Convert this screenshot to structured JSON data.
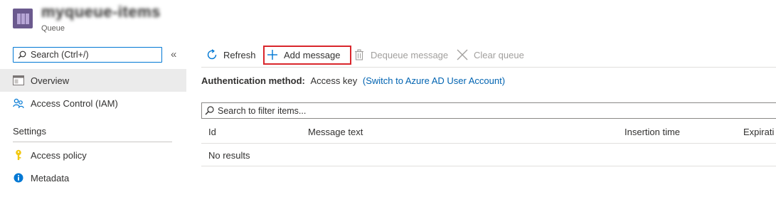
{
  "header": {
    "title": "myqueue-items",
    "subtitle": "Queue"
  },
  "sidebar": {
    "search_label": "Search (Ctrl+/)",
    "collapse_glyph": "«",
    "items": [
      {
        "label": "Overview",
        "icon": "overview-icon"
      },
      {
        "label": "Access Control (IAM)",
        "icon": "people-icon"
      }
    ],
    "section_label": "Settings",
    "settings_items": [
      {
        "label": "Access policy",
        "icon": "key-icon"
      },
      {
        "label": "Metadata",
        "icon": "info-icon"
      }
    ]
  },
  "toolbar": {
    "refresh": "Refresh",
    "add_message": "Add message",
    "dequeue_message": "Dequeue message",
    "clear_queue": "Clear queue"
  },
  "auth": {
    "label": "Authentication method:",
    "value": "Access key",
    "switch_link": "(Switch to Azure AD User Account)"
  },
  "filter": {
    "placeholder": "Search to filter items..."
  },
  "table": {
    "columns": [
      "Id",
      "Message text",
      "Insertion time",
      "Expirati"
    ],
    "empty_text": "No results"
  },
  "colors": {
    "accent": "#0078d4",
    "highlight": "#d9262c",
    "link": "#0063b1",
    "key": "#f2c811"
  }
}
